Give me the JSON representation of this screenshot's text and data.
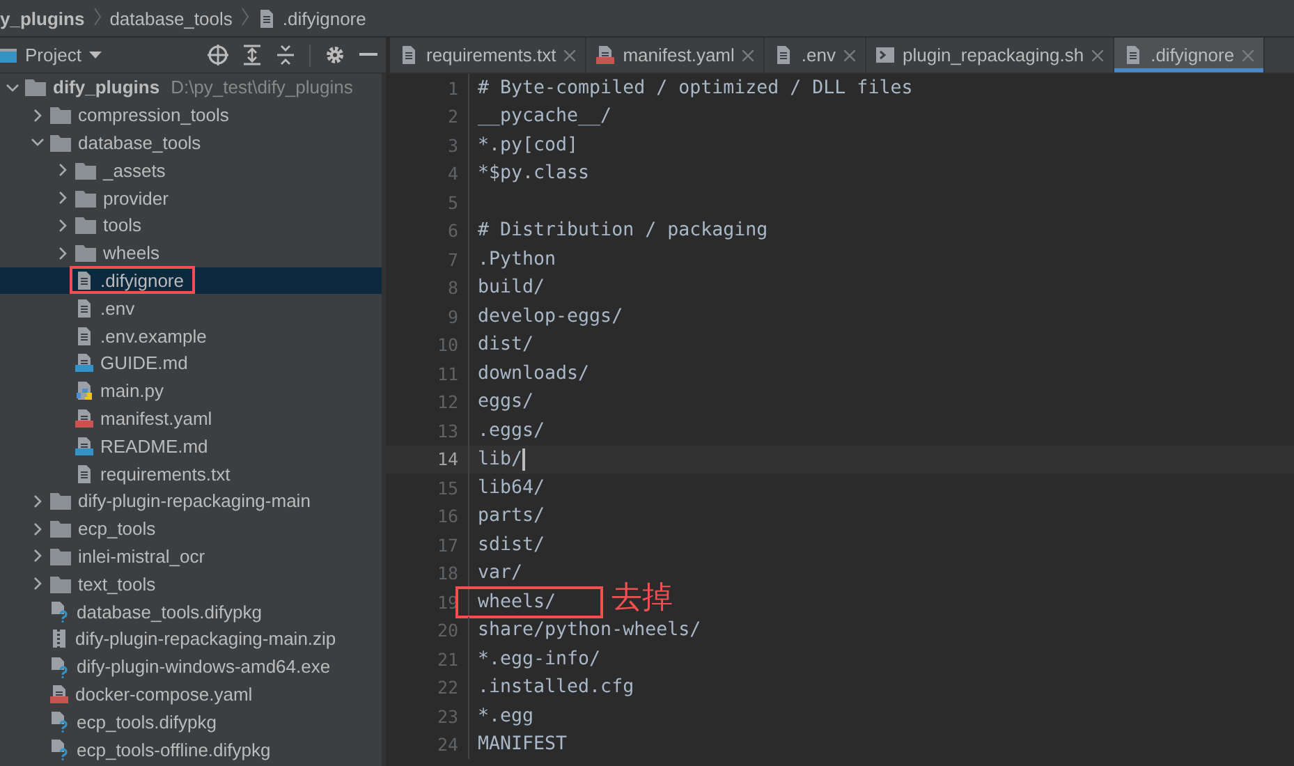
{
  "breadcrumb": [
    {
      "label": "y_plugins",
      "kind": "folder"
    },
    {
      "label": "database_tools",
      "kind": "folder"
    },
    {
      "label": ".difyignore",
      "kind": "file"
    }
  ],
  "project_panel": {
    "title": "Project",
    "tree": [
      {
        "name": "dify_plugins",
        "path": "D:\\py_test\\dify_plugins",
        "kind": "folder",
        "expanded": true,
        "selected": false,
        "marked": false,
        "children": [
          {
            "name": "compression_tools",
            "kind": "folder",
            "expanded": false,
            "selected": false,
            "marked": false
          },
          {
            "name": "database_tools",
            "kind": "folder",
            "expanded": true,
            "selected": false,
            "marked": false,
            "children": [
              {
                "name": "_assets",
                "kind": "folder",
                "expanded": false,
                "selected": false,
                "marked": false
              },
              {
                "name": "provider",
                "kind": "folder",
                "expanded": false,
                "selected": false,
                "marked": false
              },
              {
                "name": "tools",
                "kind": "folder",
                "expanded": false,
                "selected": false,
                "marked": false
              },
              {
                "name": "wheels",
                "kind": "folder",
                "expanded": false,
                "selected": false,
                "marked": false
              },
              {
                "name": ".difyignore",
                "kind": "text",
                "selected": true,
                "marked": true
              },
              {
                "name": ".env",
                "kind": "text",
                "selected": false,
                "marked": false
              },
              {
                "name": ".env.example",
                "kind": "text",
                "selected": false,
                "marked": false
              },
              {
                "name": "GUIDE.md",
                "kind": "markdown",
                "selected": false,
                "marked": false
              },
              {
                "name": "main.py",
                "kind": "python",
                "selected": false,
                "marked": false
              },
              {
                "name": "manifest.yaml",
                "kind": "yaml",
                "selected": false,
                "marked": false
              },
              {
                "name": "README.md",
                "kind": "markdown",
                "selected": false,
                "marked": false
              },
              {
                "name": "requirements.txt",
                "kind": "text",
                "selected": false,
                "marked": false
              }
            ]
          },
          {
            "name": "dify-plugin-repackaging-main",
            "kind": "folder",
            "expanded": false,
            "selected": false,
            "marked": false
          },
          {
            "name": "ecp_tools",
            "kind": "folder",
            "expanded": false,
            "selected": false,
            "marked": false
          },
          {
            "name": "inlei-mistral_ocr",
            "kind": "folder",
            "expanded": false,
            "selected": false,
            "marked": false
          },
          {
            "name": "text_tools",
            "kind": "folder",
            "expanded": false,
            "selected": false,
            "marked": false
          },
          {
            "name": "database_tools.difypkg",
            "kind": "unknown",
            "selected": false,
            "marked": false
          },
          {
            "name": "dify-plugin-repackaging-main.zip",
            "kind": "archive",
            "selected": false,
            "marked": false
          },
          {
            "name": "dify-plugin-windows-amd64.exe",
            "kind": "unknown",
            "selected": false,
            "marked": false
          },
          {
            "name": "docker-compose.yaml",
            "kind": "yaml",
            "selected": false,
            "marked": false
          },
          {
            "name": "ecp_tools.difypkg",
            "kind": "unknown",
            "selected": false,
            "marked": false
          },
          {
            "name": "ecp_tools-offline.difypkg",
            "kind": "unknown",
            "selected": false,
            "marked": false
          }
        ]
      }
    ]
  },
  "tabs": [
    {
      "label": "requirements.txt",
      "kind": "text",
      "selected": false
    },
    {
      "label": "manifest.yaml",
      "kind": "yaml",
      "selected": false
    },
    {
      "label": ".env",
      "kind": "text",
      "selected": false
    },
    {
      "label": "plugin_repackaging.sh",
      "kind": "shell",
      "selected": false
    },
    {
      "label": ".difyignore",
      "kind": "text",
      "selected": true
    }
  ],
  "editor": {
    "lines": [
      {
        "number": "1",
        "text": "# Byte-compiled / optimized / DLL files",
        "current": false,
        "marked": false
      },
      {
        "number": "2",
        "text": "__pycache__/",
        "current": false,
        "marked": false
      },
      {
        "number": "3",
        "text": "*.py[cod]",
        "current": false,
        "marked": false
      },
      {
        "number": "4",
        "text": "*$py.class",
        "current": false,
        "marked": false
      },
      {
        "number": "5",
        "current": false,
        "marked": false
      },
      {
        "number": "6",
        "text": "# Distribution / packaging",
        "current": false,
        "marked": false
      },
      {
        "number": "7",
        "text": ".Python",
        "current": false,
        "marked": false
      },
      {
        "number": "8",
        "text": "build/",
        "current": false,
        "marked": false
      },
      {
        "number": "9",
        "text": "develop-eggs/",
        "current": false,
        "marked": false
      },
      {
        "number": "10",
        "text": "dist/",
        "current": false,
        "marked": false
      },
      {
        "number": "11",
        "text": "downloads/",
        "current": false,
        "marked": false
      },
      {
        "number": "12",
        "text": "eggs/",
        "current": false,
        "marked": false
      },
      {
        "number": "13",
        "text": ".eggs/",
        "current": false,
        "marked": false
      },
      {
        "number": "14",
        "text": "lib/",
        "current": true,
        "marked": false
      },
      {
        "number": "15",
        "text": "lib64/",
        "current": false,
        "marked": false
      },
      {
        "number": "16",
        "text": "parts/",
        "current": false,
        "marked": false
      },
      {
        "number": "17",
        "text": "sdist/",
        "current": false,
        "marked": false
      },
      {
        "number": "18",
        "text": "var/",
        "current": false,
        "marked": false
      },
      {
        "number": "19",
        "text": "wheels/",
        "current": false,
        "marked": true,
        "note": "去掉"
      },
      {
        "number": "20",
        "text": "share/python-wheels/",
        "current": false,
        "marked": false
      },
      {
        "number": "21",
        "text": "*.egg-info/",
        "current": false,
        "marked": false
      },
      {
        "number": "22",
        "text": ".installed.cfg",
        "current": false,
        "marked": false
      },
      {
        "number": "23",
        "text": "*.egg",
        "current": false,
        "marked": false
      },
      {
        "number": "24",
        "text": "MANIFEST",
        "current": false,
        "marked": false
      }
    ]
  }
}
